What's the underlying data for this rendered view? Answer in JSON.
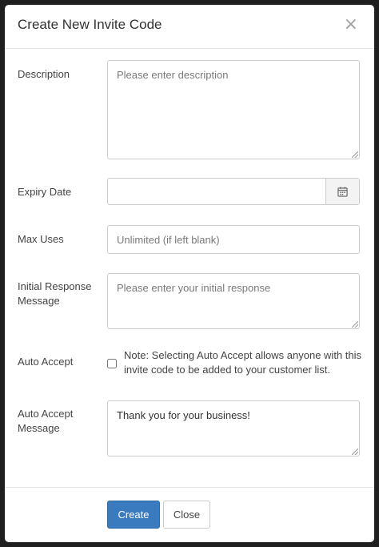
{
  "modal": {
    "title": "Create New Invite Code",
    "close_symbol": "×"
  },
  "form": {
    "description": {
      "label": "Description",
      "placeholder": "Please enter description",
      "value": ""
    },
    "expiry_date": {
      "label": "Expiry Date",
      "value": "",
      "icon": "calendar-icon"
    },
    "max_uses": {
      "label": "Max Uses",
      "placeholder": "Unlimited (if left blank)",
      "value": ""
    },
    "initial_response": {
      "label": "Initial Response Message",
      "placeholder": "Please enter your initial response",
      "value": ""
    },
    "auto_accept": {
      "label": "Auto Accept",
      "checked": false,
      "note": "Note: Selecting Auto Accept allows anyone with this invite code to be added to your customer list."
    },
    "auto_accept_message": {
      "label": "Auto Accept Message",
      "value": "Thank you for your business!"
    }
  },
  "footer": {
    "create_label": "Create",
    "close_label": "Close"
  },
  "colors": {
    "primary": "#3a7bbf",
    "backdrop": "#1f1f1f"
  }
}
